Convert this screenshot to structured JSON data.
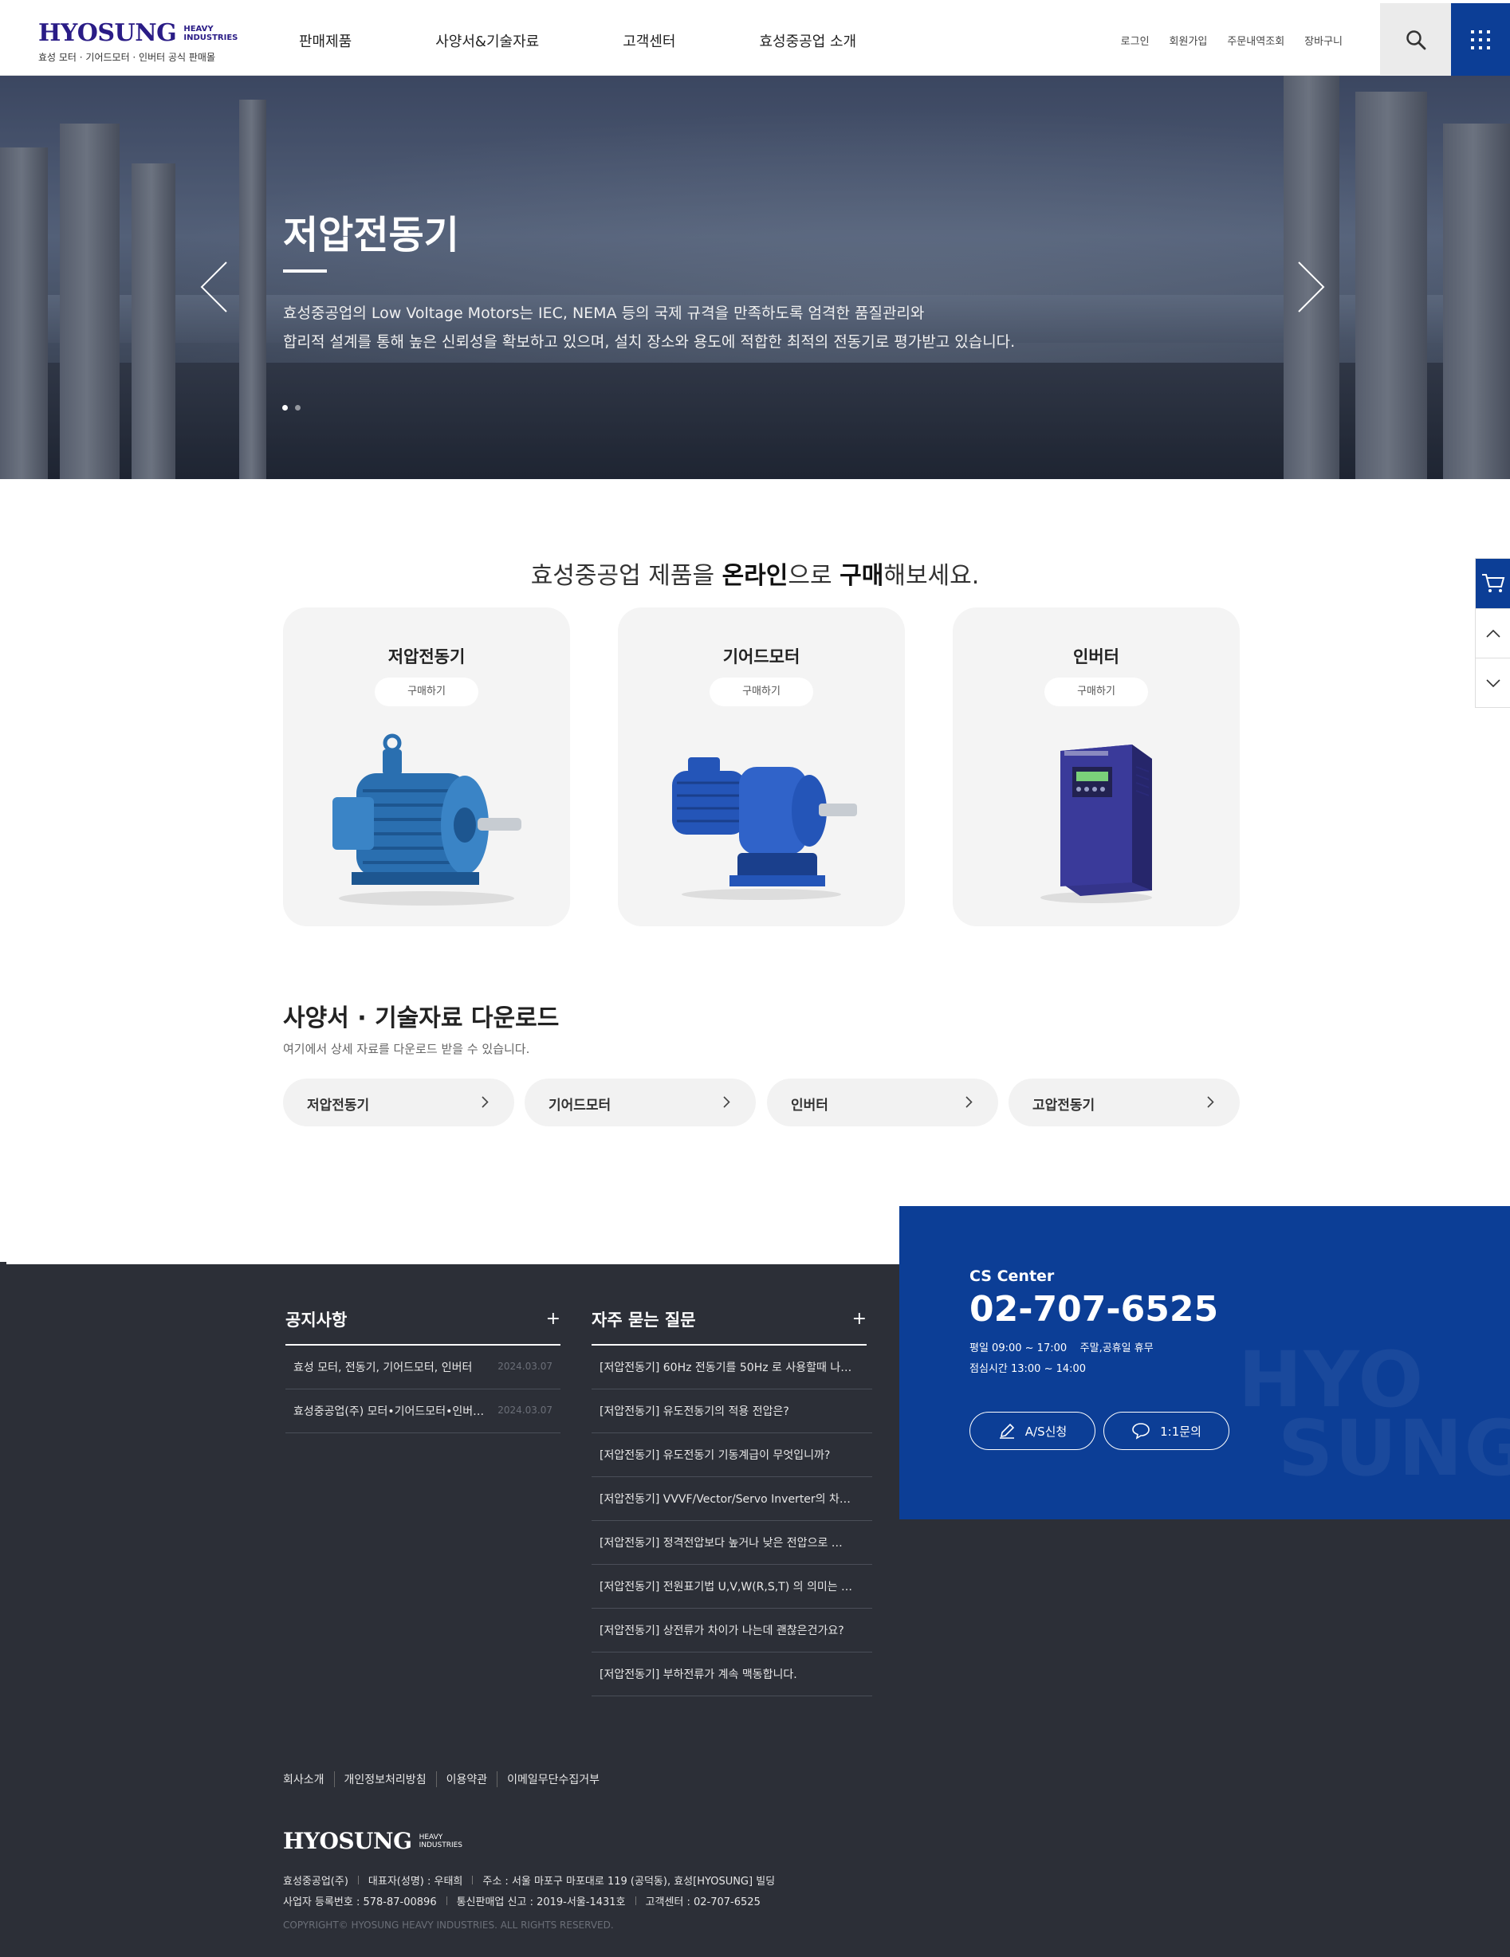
{
  "header": {
    "logo_main": "HYOSUNG",
    "logo_side_1": "HEAVY",
    "logo_side_2": "INDUSTRIES",
    "logo_tagline": "효성 모터 · 기어드모터 · 인버터 공식 판매몰",
    "nav": [
      "판매제품",
      "사양서&기술자료",
      "고객센터",
      "효성중공업 소개"
    ],
    "util": [
      "로그인",
      "회원가입",
      "주문내역조회",
      "장바구니"
    ],
    "search_icon": "search-icon",
    "menu_icon": "grid-menu-icon"
  },
  "hero": {
    "title": "저압전동기",
    "desc_line1": "효성중공업의 Low Voltage Motors는 IEC, NEMA 등의 국제 규격을 만족하도록 엄격한 품질관리와",
    "desc_line2": "합리적 설계를 통해 높은 신뢰성을 확보하고 있으며, 설치 장소와 용도에 적합한 최적의 전동기로 평가받고 있습니다.",
    "slide_count": 2,
    "active_slide": 1
  },
  "shop": {
    "title_pre": "효성중공업 제품을 ",
    "title_b1": "온라인",
    "title_mid": "으로 ",
    "title_b2": "구매",
    "title_post": "해보세요.",
    "cards": [
      {
        "name": "저압전동기",
        "button": "구매하기",
        "color": "#2a6fb0"
      },
      {
        "name": "기어드모터",
        "button": "구매하기",
        "color": "#2455b8"
      },
      {
        "name": "인버터",
        "button": "구매하기",
        "color": "#3a3a92"
      }
    ]
  },
  "downloads": {
    "title": "사양서 · 기술자료 다운로드",
    "subtitle": "여기에서 상세 자료를 다운로드 받을 수 있습니다.",
    "items": [
      "저압전동기",
      "기어드모터",
      "인버터",
      "고압전동기"
    ]
  },
  "notice": {
    "title": "공지사항",
    "items": [
      {
        "text": "효성 모터, 전동기, 기어드모터, 인버터",
        "date": "2024.03.07"
      },
      {
        "text": "효성중공업(주) 모터•기어드모터•인버터…",
        "date": "2024.03.07"
      }
    ]
  },
  "faq": {
    "title": "자주 묻는 질문",
    "items": [
      "[저압전동기] 60Hz 전동기를 50Hz 로 사용할때 나…",
      "[저압전동기] 유도전동기의 적용 전압은?",
      "[저압전동기] 유도전동기 기동계급이 무엇입니까?",
      "[저압전동기] VVVF/Vector/Servo Inverter의 차…",
      "[저압전동기] 정격전압보다 높거나 낮은 전압으로 …",
      "[저압전동기] 전원표기법 U,V,W(R,S,T) 의 의미는 …",
      "[저압전동기] 상전류가 차이가 나는데 괜찮은건가요?",
      "[저압전동기] 부하전류가 계속 맥동합니다."
    ]
  },
  "cs": {
    "label": "CS Center",
    "phone": "02-707-6525",
    "hours_1": "평일 09:00 ~ 17:00    주말,공휴일 휴무",
    "hours_2": "점심시간 13:00 ~ 14:00",
    "as_button": "A/S신청",
    "qna_button": "1:1문의",
    "watermark_1": "HYO",
    "watermark_2": "SUNG"
  },
  "footer": {
    "links": [
      "회사소개",
      "개인정보처리방침",
      "이용약관",
      "이메일무단수집거부"
    ],
    "logo_main": "HYOSUNG",
    "logo_side_1": "HEAVY",
    "logo_side_2": "INDUSTRIES",
    "company": "효성중공업(주)",
    "ceo": "대표자(성명) : 우태희",
    "address": "주소 : 서울 마포구 마포대로 119 (공덕동), 효성[HYOSUNG] 빌딩",
    "biz_no": "사업자 등록번호 : 578-87-00896",
    "mail_order": "통신판매업 신고 : 2019-서울-1431호",
    "cs_center": "고객센터 : 02-707-6525",
    "copyright": "COPYRIGHT© HYOSUNG HEAVY INDUSTRIES. ALL RIGHTS RESERVED."
  },
  "quick": {
    "cart_icon": "cart-icon",
    "up_icon": "chevron-up-icon",
    "down_icon": "chevron-down-icon"
  },
  "colors": {
    "brand_navy": "#2a1c86",
    "brand_blue": "#0c3e96",
    "footer_bg": "#2c2f37"
  }
}
